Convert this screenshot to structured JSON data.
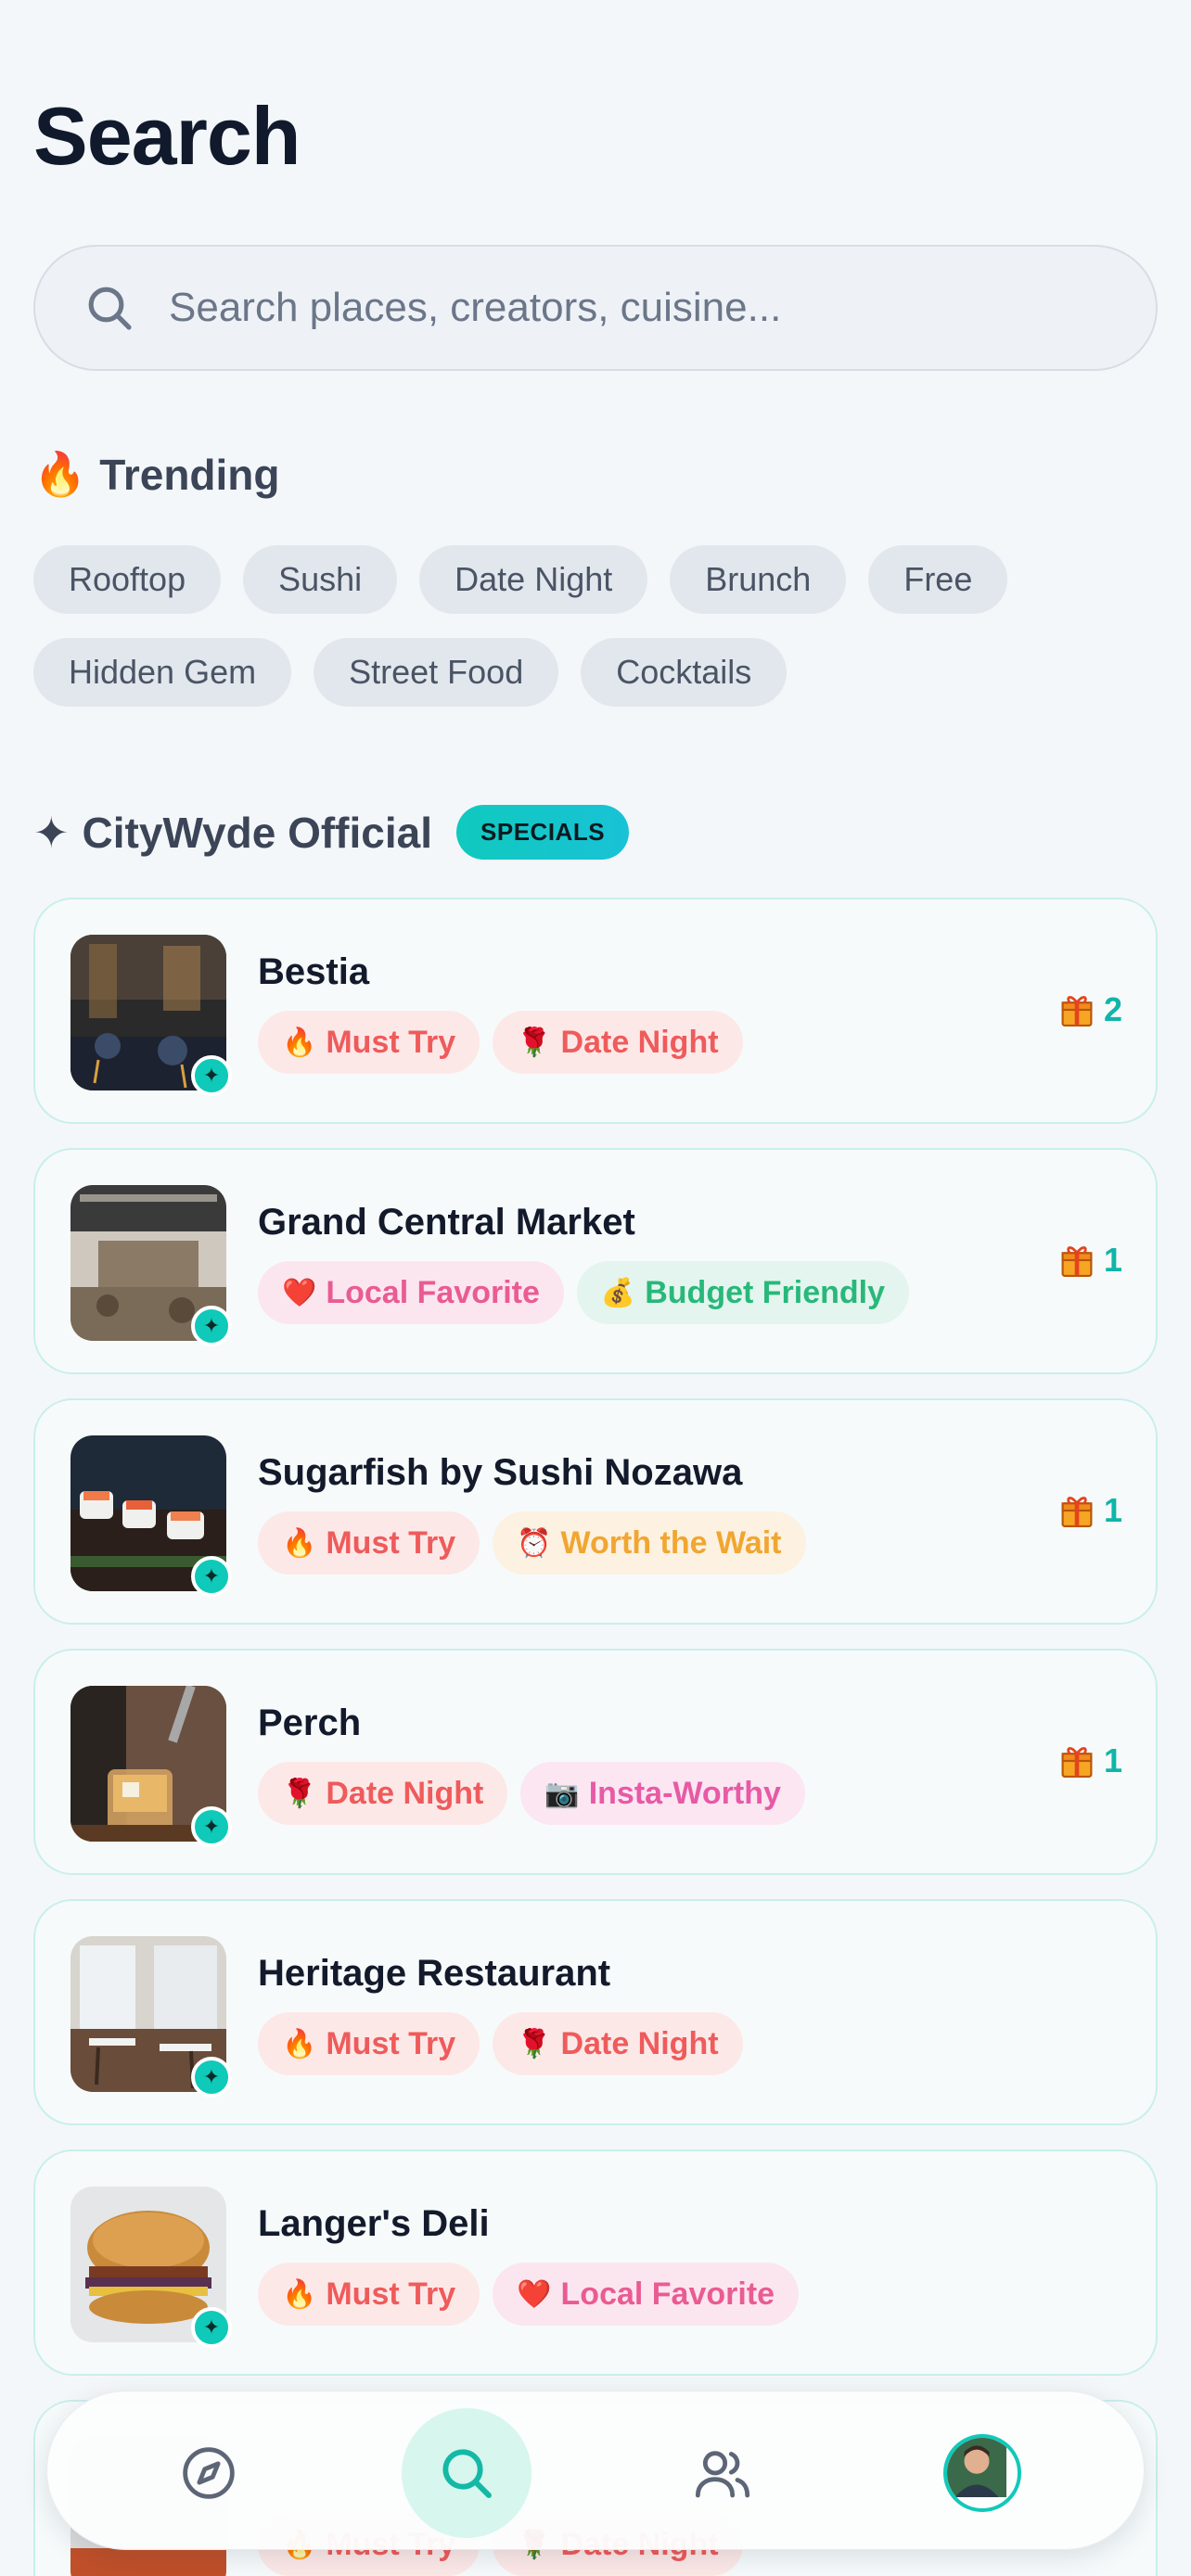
{
  "header": {
    "title": "Search"
  },
  "search": {
    "placeholder": "Search places, creators, cuisine..."
  },
  "trending": {
    "title": "Trending",
    "icon": "fire-icon",
    "chips": [
      "Rooftop",
      "Sushi",
      "Date Night",
      "Brunch",
      "Free",
      "Hidden Gem",
      "Street Food",
      "Cocktails"
    ]
  },
  "official": {
    "title": "CityWyde Official",
    "badge": "SPECIALS",
    "places": [
      {
        "name": "Bestia",
        "gifts": "2",
        "tags": [
          {
            "icon": "🔥",
            "label": "Must Try",
            "style": "red"
          },
          {
            "icon": "🌹",
            "label": "Date Night",
            "style": "red"
          }
        ]
      },
      {
        "name": "Grand Central Market",
        "gifts": "1",
        "tags": [
          {
            "icon": "❤️",
            "label": "Local Favorite",
            "style": "pink"
          },
          {
            "icon": "💰",
            "label": "Budget Friendly",
            "style": "green"
          }
        ]
      },
      {
        "name": "Sugarfish by Sushi Nozawa",
        "gifts": "1",
        "tags": [
          {
            "icon": "🔥",
            "label": "Must Try",
            "style": "red"
          },
          {
            "icon": "⏰",
            "label": "Worth the Wait",
            "style": "amber"
          }
        ]
      },
      {
        "name": "Perch",
        "gifts": "1",
        "tags": [
          {
            "icon": "🌹",
            "label": "Date Night",
            "style": "red"
          },
          {
            "icon": "📷",
            "label": "Insta-Worthy",
            "style": "magenta"
          }
        ]
      },
      {
        "name": "Heritage Restaurant",
        "gifts": "",
        "tags": [
          {
            "icon": "🔥",
            "label": "Must Try",
            "style": "red"
          },
          {
            "icon": "🌹",
            "label": "Date Night",
            "style": "red"
          }
        ]
      },
      {
        "name": "Langer's Deli",
        "gifts": "",
        "tags": [
          {
            "icon": "🔥",
            "label": "Must Try",
            "style": "red"
          },
          {
            "icon": "❤️",
            "label": "Local Favorite",
            "style": "pink"
          }
        ]
      },
      {
        "name": "",
        "gifts": "",
        "tags": [
          {
            "icon": "🔥",
            "label": "Must Try",
            "style": "red"
          },
          {
            "icon": "🌹",
            "label": "Date Night",
            "style": "red"
          }
        ]
      }
    ]
  },
  "nav": {
    "items": [
      {
        "name": "explore",
        "icon": "compass-icon"
      },
      {
        "name": "search",
        "icon": "search-icon",
        "active": true
      },
      {
        "name": "friends",
        "icon": "people-icon"
      },
      {
        "name": "profile",
        "icon": "avatar"
      }
    ]
  },
  "colors": {
    "accent": "#10c9b9",
    "background": "#f4f7f9"
  }
}
